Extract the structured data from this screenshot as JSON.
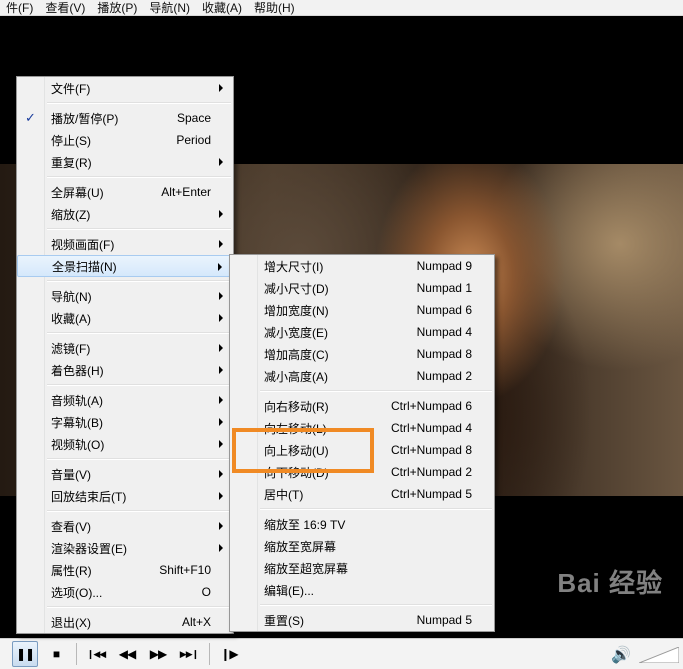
{
  "menubar": [
    "件(F)",
    "查看(V)",
    "播放(P)",
    "导航(N)",
    "收藏(A)",
    "帮助(H)"
  ],
  "main_menu": [
    {
      "label": "文件(F)",
      "shortcut": "",
      "submenu": true
    },
    {
      "sep": true
    },
    {
      "label": "播放/暂停(P)",
      "shortcut": "Space",
      "checked": true
    },
    {
      "label": "停止(S)",
      "shortcut": "Period"
    },
    {
      "label": "重复(R)",
      "shortcut": "",
      "submenu": true
    },
    {
      "sep": true
    },
    {
      "label": "全屏幕(U)",
      "shortcut": "Alt+Enter"
    },
    {
      "label": "缩放(Z)",
      "shortcut": "",
      "submenu": true
    },
    {
      "sep": true
    },
    {
      "label": "视频画面(F)",
      "shortcut": "",
      "submenu": true
    },
    {
      "label": "全景扫描(N)",
      "shortcut": "",
      "submenu": true,
      "highlighted": true
    },
    {
      "sep": true
    },
    {
      "label": "导航(N)",
      "shortcut": "",
      "submenu": true
    },
    {
      "label": "收藏(A)",
      "shortcut": "",
      "submenu": true
    },
    {
      "sep": true
    },
    {
      "label": "滤镜(F)",
      "shortcut": "",
      "submenu": true
    },
    {
      "label": "着色器(H)",
      "shortcut": "",
      "submenu": true
    },
    {
      "sep": true
    },
    {
      "label": "音频轨(A)",
      "shortcut": "",
      "submenu": true
    },
    {
      "label": "字幕轨(B)",
      "shortcut": "",
      "submenu": true
    },
    {
      "label": "视频轨(O)",
      "shortcut": "",
      "submenu": true
    },
    {
      "sep": true
    },
    {
      "label": "音量(V)",
      "shortcut": "",
      "submenu": true
    },
    {
      "label": "回放结束后(T)",
      "shortcut": "",
      "submenu": true
    },
    {
      "sep": true
    },
    {
      "label": "查看(V)",
      "shortcut": "",
      "submenu": true
    },
    {
      "label": "渲染器设置(E)",
      "shortcut": "",
      "submenu": true
    },
    {
      "label": "属性(R)",
      "shortcut": "Shift+F10"
    },
    {
      "label": "选项(O)...",
      "shortcut": "O"
    },
    {
      "sep": true
    },
    {
      "label": "退出(X)",
      "shortcut": "Alt+X"
    }
  ],
  "pan_scan_menu": [
    {
      "label": "增大尺寸(I)",
      "shortcut": "Numpad 9"
    },
    {
      "label": "减小尺寸(D)",
      "shortcut": "Numpad 1"
    },
    {
      "label": "增加宽度(N)",
      "shortcut": "Numpad 6"
    },
    {
      "label": "减小宽度(E)",
      "shortcut": "Numpad 4"
    },
    {
      "label": "增加高度(C)",
      "shortcut": "Numpad 8"
    },
    {
      "label": "减小高度(A)",
      "shortcut": "Numpad 2"
    },
    {
      "sep": true
    },
    {
      "label": "向右移动(R)",
      "shortcut": "Ctrl+Numpad 6"
    },
    {
      "label": "向左移动(L)",
      "shortcut": "Ctrl+Numpad 4"
    },
    {
      "label": "向上移动(U)",
      "shortcut": "Ctrl+Numpad 8"
    },
    {
      "label": "向下移动(D)",
      "shortcut": "Ctrl+Numpad 2"
    },
    {
      "label": "居中(T)",
      "shortcut": "Ctrl+Numpad 5"
    },
    {
      "sep": true
    },
    {
      "label": "缩放至 16:9 TV",
      "shortcut": ""
    },
    {
      "label": "缩放至宽屏幕",
      "shortcut": ""
    },
    {
      "label": "缩放至超宽屏幕",
      "shortcut": ""
    },
    {
      "label": "编辑(E)...",
      "shortcut": ""
    },
    {
      "sep": true
    },
    {
      "label": "重置(S)",
      "shortcut": "Numpad 5"
    }
  ],
  "controls": [
    {
      "name": "pause-button",
      "glyph": "❚❚"
    },
    {
      "name": "stop-button",
      "glyph": "■"
    },
    {
      "sep": true
    },
    {
      "name": "previous-button",
      "glyph": "❙◀◀"
    },
    {
      "name": "rewind-button",
      "glyph": "◀◀"
    },
    {
      "name": "fast-forward-button",
      "glyph": "▶▶"
    },
    {
      "name": "next-button",
      "glyph": "▶▶❙"
    },
    {
      "sep": true
    },
    {
      "name": "frame-step-button",
      "glyph": "❙▶"
    }
  ],
  "volume_glyph": "🔊",
  "watermark": "Bai 经验",
  "annotation_color": "#f08a24"
}
